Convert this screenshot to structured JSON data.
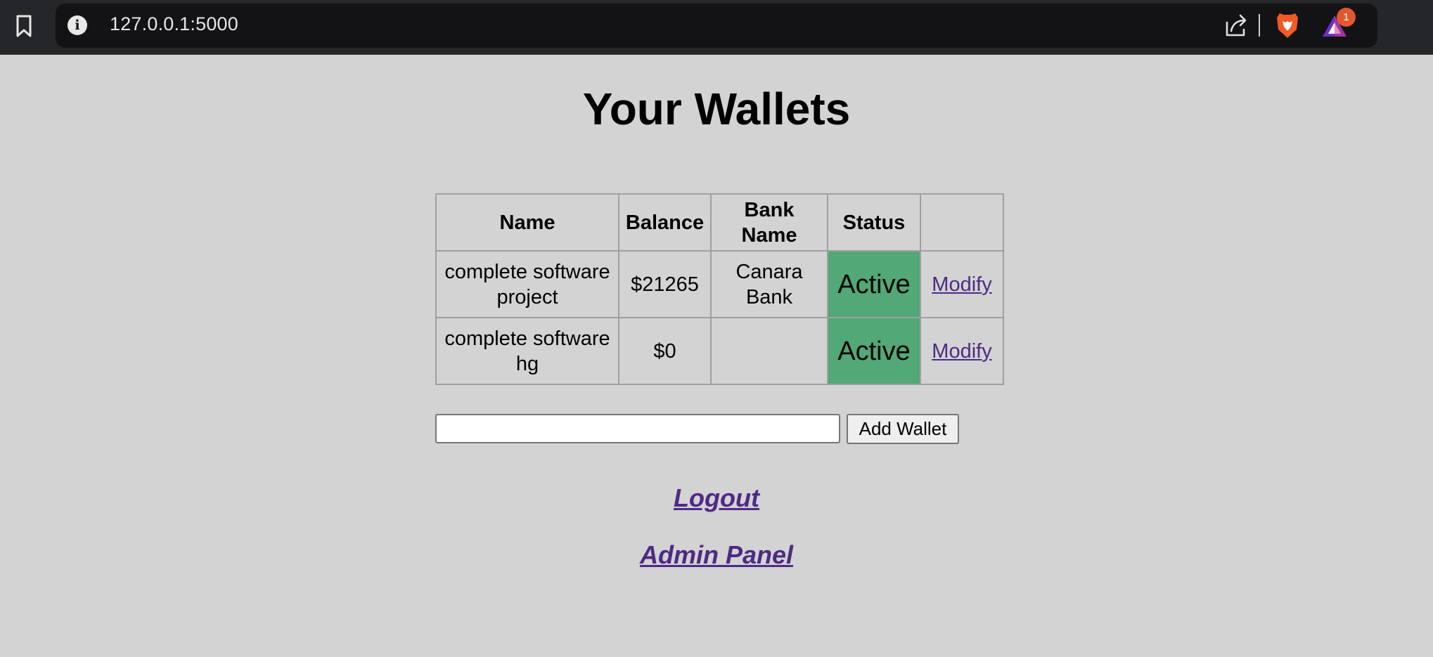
{
  "browser": {
    "url": "127.0.0.1:5000",
    "rewards_badge_count": "1"
  },
  "page": {
    "title": "Your Wallets"
  },
  "table": {
    "headers": [
      "Name",
      "Balance",
      "Bank\nName",
      "Status",
      ""
    ],
    "rows": [
      {
        "name": "complete software project",
        "balance": "$21265",
        "bank_name": "Canara Bank",
        "status": "Active",
        "action": "Modify"
      },
      {
        "name": "complete software hg",
        "balance": "$0",
        "bank_name": "",
        "status": "Active",
        "action": "Modify"
      }
    ]
  },
  "form": {
    "wallet_name_value": "",
    "add_button_label": "Add Wallet"
  },
  "links": {
    "logout": "Logout",
    "admin_panel": "Admin Panel"
  },
  "colors": {
    "status_active": "#52a876",
    "link": "#4e2a84",
    "page_background": "#d3d3d3"
  },
  "icons": [
    "bookmark-icon",
    "info-icon",
    "share-icon",
    "brave-lion-icon",
    "brave-rewards-icon"
  ]
}
